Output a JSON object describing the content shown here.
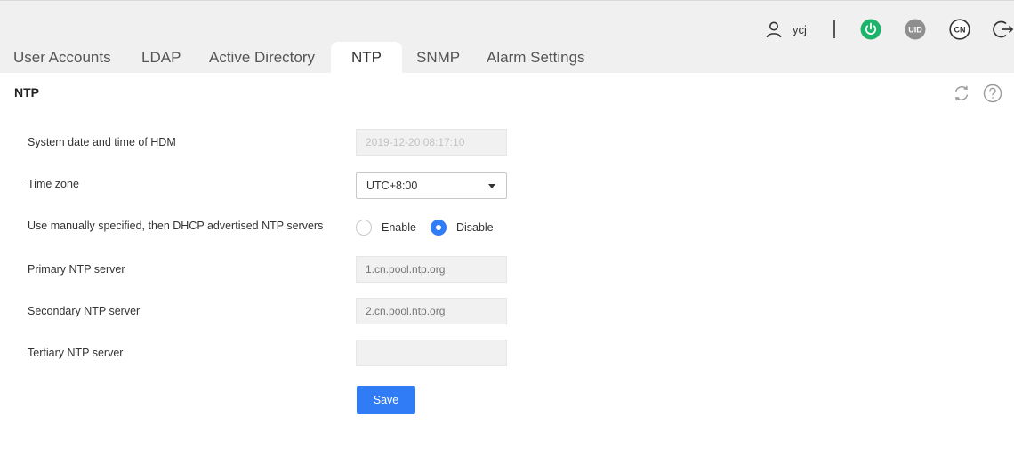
{
  "header": {
    "username": "ycj",
    "icons": [
      "user-icon",
      "power-icon",
      "uid-icon",
      "language-icon",
      "logout-icon"
    ],
    "uid_label": "UID",
    "lang_label": "CN",
    "colors": {
      "power": "#1db36b",
      "uid": "#8e8e8e"
    }
  },
  "tabs": [
    {
      "label": "User Accounts"
    },
    {
      "label": "LDAP"
    },
    {
      "label": "Active Directory"
    },
    {
      "label": "NTP",
      "active": true
    },
    {
      "label": "SNMP"
    },
    {
      "label": "Alarm Settings"
    }
  ],
  "panel": {
    "title": "NTP",
    "tool_icons": [
      "refresh-icon",
      "help-icon"
    ]
  },
  "form": {
    "system_time": {
      "label": "System date and time of HDM",
      "value": "2019-12-20 08:17:10"
    },
    "time_zone": {
      "label": "Time zone",
      "value": "UTC+8:00"
    },
    "manual_dhcp": {
      "label": "Use manually specified, then DHCP advertised NTP servers",
      "options": [
        {
          "label": "Enable",
          "checked": false
        },
        {
          "label": "Disable",
          "checked": true
        }
      ]
    },
    "primary": {
      "label": "Primary NTP server",
      "placeholder": "1.cn.pool.ntp.org"
    },
    "secondary": {
      "label": "Secondary NTP server",
      "placeholder": "2.cn.pool.ntp.org"
    },
    "tertiary": {
      "label": "Tertiary NTP server",
      "placeholder": ""
    },
    "save_label": "Save"
  },
  "accent_color": "#2f7cf6"
}
